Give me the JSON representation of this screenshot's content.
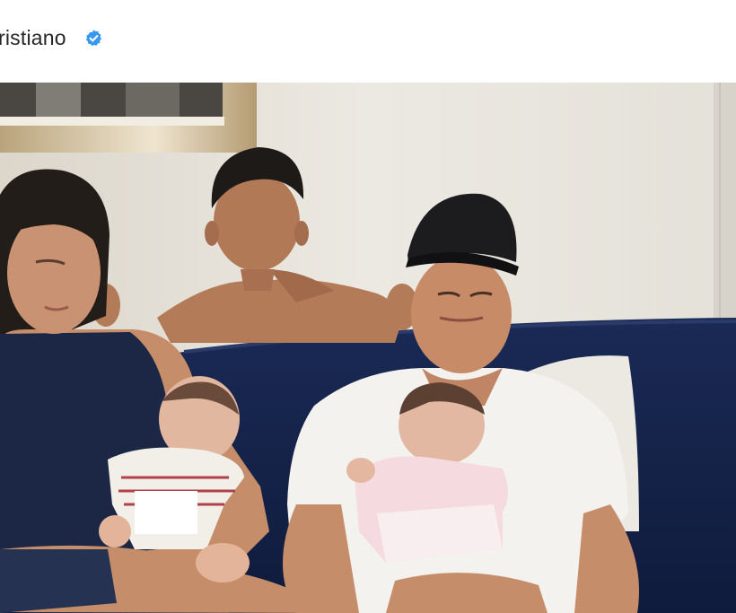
{
  "post": {
    "username": "ristiano",
    "verified_icon": "verified-badge-icon",
    "accent_color": "#3897f0"
  },
  "photo": {
    "subject": "family-portrait-photo"
  }
}
